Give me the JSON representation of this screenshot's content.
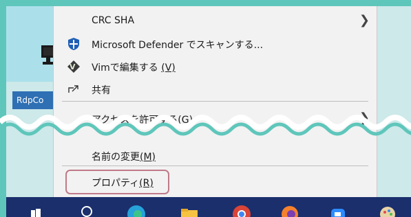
{
  "desktop": {
    "icon_label": "RdpCo"
  },
  "menu": {
    "items": [
      {
        "label": "CRC SHA",
        "icon": "none",
        "submenu": true
      },
      {
        "label": "Microsoft Defender でスキャンする...",
        "icon": "defender-shield-icon",
        "submenu": false
      },
      {
        "label": "Vimで編集する",
        "accel": "(V)",
        "icon": "vim-icon",
        "submenu": false
      },
      {
        "label": "共有",
        "icon": "share-icon",
        "submenu": false
      },
      {
        "label": "アクセスを許可する(G)",
        "icon": "none",
        "submenu": true
      },
      {
        "label": "名前の変更",
        "accel": "(M)",
        "icon": "none",
        "submenu": false
      },
      {
        "label": "プロパティ",
        "accel": "(R)",
        "icon": "none",
        "submenu": false,
        "highlighted": true
      }
    ]
  },
  "taskbar": {
    "items": [
      "start-icon",
      "search-icon",
      "edge-icon",
      "file-explorer-icon",
      "chrome-icon",
      "firefox-icon",
      "zoom-icon",
      "paint-icon"
    ]
  },
  "colors": {
    "background": "#5fc6bb",
    "menu": "#f2f2f2",
    "taskbar": "#1a2f6c",
    "highlight": "#c07988"
  }
}
